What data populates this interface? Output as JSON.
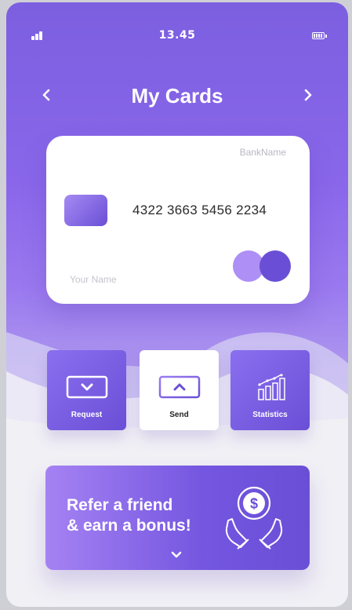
{
  "status_bar": {
    "time": "13.45"
  },
  "header": {
    "title": "My Cards"
  },
  "card": {
    "bank_name": "BankName",
    "number": "4322 3663 5456 2234",
    "holder": "Your Name"
  },
  "actions": [
    {
      "label": "Request",
      "icon": "chevron-down-icon"
    },
    {
      "label": "Send",
      "icon": "chevron-up-icon"
    },
    {
      "label": "Statistics",
      "icon": "bar-chart-icon"
    }
  ],
  "refer": {
    "line1": "Refer a friend",
    "line2": "& earn a bonus!"
  },
  "colors": {
    "primary": "#7c5fe0",
    "dark": "#6a4fd6",
    "light": "#ad8ff5",
    "background": "#f1f0f5"
  }
}
